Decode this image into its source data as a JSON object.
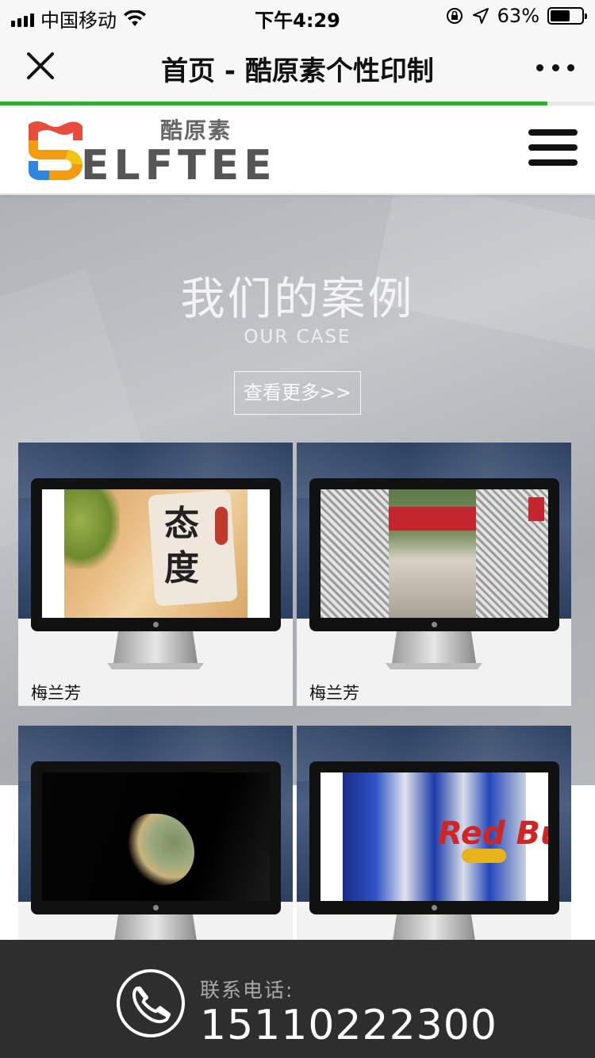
{
  "status_bar": {
    "carrier": "中国移动",
    "time": "下午4:29",
    "battery": "63%",
    "battery_level": 0.63
  },
  "nav_bar": {
    "title": "首页 - 酷原素个性印制",
    "page_load_progress": 0.92
  },
  "header": {
    "logo_cn": "酷原素",
    "logo_en": "ELFTEE",
    "logo_colors": [
      "#e84c3d",
      "#f39c12",
      "#2e86de",
      "#f1c40f"
    ]
  },
  "case_section": {
    "title": "我们的案例",
    "subtitle": "OUR CASE",
    "more_label": "查看更多>>"
  },
  "cases": [
    {
      "label": "梅兰芳",
      "screen_text": "态度"
    },
    {
      "label": "梅兰芳"
    },
    {
      "label": ""
    },
    {
      "label": "",
      "screen_text": "Red Bull"
    }
  ],
  "contact": {
    "label": "联系电话:",
    "phone": "15110222300"
  },
  "colors": {
    "progress_green": "#2db22d",
    "footer_bg": "#2e2e2e"
  }
}
